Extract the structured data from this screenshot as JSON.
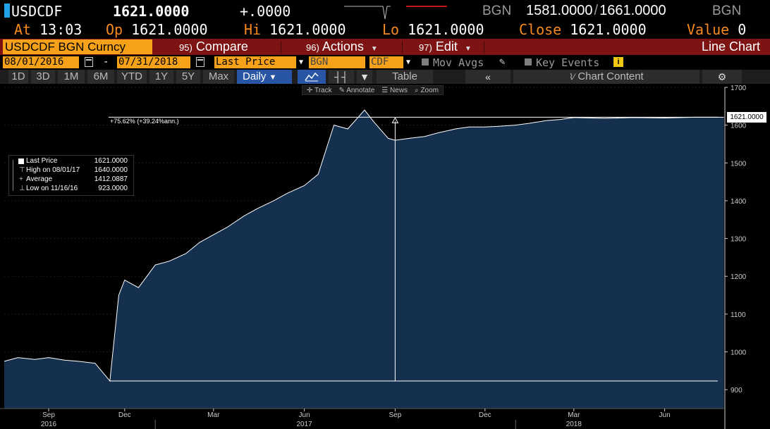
{
  "header": {
    "ticker": "USDCDF",
    "last_price": "1621.0000",
    "change": "+.0000",
    "source_left": "BGN",
    "bid": "1581.0000",
    "ask": "1661.0000",
    "source_right": "BGN"
  },
  "stats": {
    "at_label": "At",
    "at_value": "13:03",
    "open_label": "Op",
    "open_value": "1621.0000",
    "high_label": "Hi",
    "high_value": "1621.0000",
    "low_label": "Lo",
    "low_value": "1621.0000",
    "close_label": "Close",
    "close_value": "1621.0000",
    "value_label": "Value",
    "value_value": "0"
  },
  "menu": {
    "security": "USDCDF BGN Curncy",
    "compare_num": "95)",
    "compare": "Compare",
    "actions_num": "96)",
    "actions": "Actions",
    "edit_num": "97)",
    "edit": "Edit",
    "chart_type": "Line Chart"
  },
  "controls": {
    "start_date": "08/01/2016",
    "end_date": "07/31/2018",
    "field": "Last Price",
    "source": "BGN",
    "currency": "CDF",
    "mov_avgs": "Mov Avgs",
    "key_events": "Key Events",
    "info_icon": "i"
  },
  "range_toolbar": {
    "ranges": [
      "1D",
      "3D",
      "1M",
      "6M",
      "YTD",
      "1Y",
      "5Y",
      "Max"
    ],
    "period": "Daily",
    "table": "Table",
    "chart_content": "Chart Content"
  },
  "chart_tools": {
    "track": "Track",
    "annotate": "Annotate",
    "news": "News",
    "zoom": "Zoom"
  },
  "legend": {
    "last_price_label": "Last Price",
    "last_price_value": "1621.0000",
    "high_label": "High on 08/01/17",
    "high_value": "1640.0000",
    "average_label": "Average",
    "average_value": "1412.0887",
    "low_label": "Low on 11/16/16",
    "low_value": "923.0000"
  },
  "annotation": "+75.62% (+39.24%ann.)",
  "price_tag": "1621.0000",
  "colors": {
    "background": "#000000",
    "orange": "#f6a11a",
    "label_orange": "#f68a1f",
    "menu_red": "#7d1313",
    "toolbar_blue": "#2955a5",
    "area_fill": "#15304f",
    "line": "#ffffff"
  },
  "chart_data": {
    "type": "area",
    "series": [
      {
        "name": "Last Price",
        "x": [
          "2016-08-01",
          "2016-08-15",
          "2016-09-01",
          "2016-09-15",
          "2016-10-01",
          "2016-10-15",
          "2016-11-01",
          "2016-11-16",
          "2016-11-25",
          "2016-12-01",
          "2016-12-15",
          "2017-01-01",
          "2017-01-15",
          "2017-02-01",
          "2017-02-15",
          "2017-03-01",
          "2017-03-15",
          "2017-04-01",
          "2017-04-15",
          "2017-05-01",
          "2017-05-15",
          "2017-06-01",
          "2017-06-15",
          "2017-07-01",
          "2017-07-15",
          "2017-08-01",
          "2017-08-10",
          "2017-08-25",
          "2017-09-01",
          "2017-09-15",
          "2017-10-01",
          "2017-10-15",
          "2017-11-01",
          "2017-11-15",
          "2017-12-01",
          "2017-12-15",
          "2018-01-01",
          "2018-01-15",
          "2018-02-01",
          "2018-02-15",
          "2018-03-01",
          "2018-04-01",
          "2018-05-01",
          "2018-06-01",
          "2018-07-01",
          "2018-07-31"
        ],
        "values": [
          975,
          985,
          980,
          985,
          978,
          975,
          970,
          923,
          1150,
          1190,
          1170,
          1230,
          1240,
          1260,
          1290,
          1310,
          1330,
          1360,
          1380,
          1400,
          1420,
          1440,
          1470,
          1600,
          1590,
          1640,
          1610,
          1565,
          1560,
          1565,
          1570,
          1580,
          1590,
          1595,
          1595,
          1597,
          1600,
          1605,
          1612,
          1615,
          1620,
          1618,
          1620,
          1619,
          1621,
          1621
        ]
      }
    ],
    "ylim": [
      850,
      1700
    ],
    "yticks": [
      900,
      1000,
      1100,
      1200,
      1300,
      1400,
      1500,
      1600,
      1700
    ],
    "xticks": [
      {
        "date": "2016-09-15",
        "label": "Sep"
      },
      {
        "date": "2016-12-01",
        "label": "Dec"
      },
      {
        "date": "2017-03-01",
        "label": "Mar"
      },
      {
        "date": "2017-06-01",
        "label": "Jun"
      },
      {
        "date": "2017-09-01",
        "label": "Sep"
      },
      {
        "date": "2017-12-01",
        "label": "Dec"
      },
      {
        "date": "2018-03-01",
        "label": "Mar"
      },
      {
        "date": "2018-06-01",
        "label": "Jun"
      }
    ],
    "year_labels": [
      {
        "date": "2016-09-15",
        "label": "2016"
      },
      {
        "date": "2017-06-01",
        "label": "2017"
      },
      {
        "date": "2018-03-01",
        "label": "2018"
      }
    ],
    "year_boundaries": [
      "2017-01-01",
      "2018-01-01"
    ],
    "x_range": [
      "2016-08-01",
      "2018-08-01"
    ],
    "measurement": {
      "start_date": "2016-11-16",
      "start_value": 923,
      "end_date": "2017-09-01",
      "end_value": 1621
    }
  }
}
